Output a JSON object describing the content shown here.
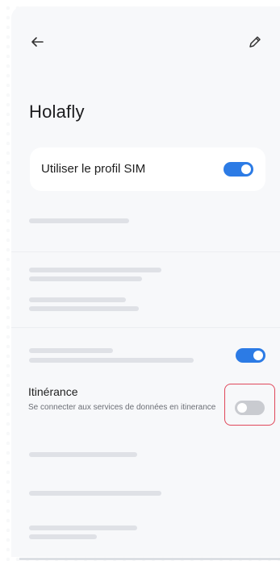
{
  "header": {
    "back_icon": "arrow-left-icon",
    "edit_icon": "pencil-icon"
  },
  "page": {
    "title": "Holafly"
  },
  "sim_profile": {
    "label": "Utiliser le profil SIM",
    "enabled": true
  },
  "roaming": {
    "title": "Itinérance",
    "description": "Se connecter aux services de données en itinerance",
    "enabled": false
  },
  "colors": {
    "accent": "#2c7be5",
    "highlight": "#e0475a",
    "background": "#f7f8fa"
  }
}
